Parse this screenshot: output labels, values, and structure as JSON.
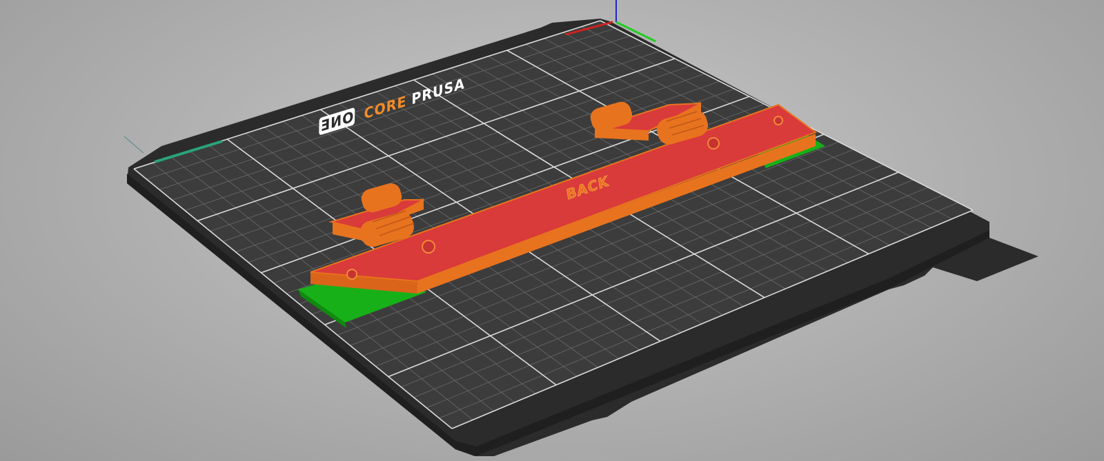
{
  "view": {
    "type": "3d-plater-view"
  },
  "bed": {
    "brand_word_1": "PRUSA",
    "brand_word_2": "CORE",
    "brand_badge": "ONE",
    "plate_color": "#3a3a3a",
    "frame_color": "#2a2a2a",
    "grid_color": "#6b6b6b",
    "grid_major_color": "#dcdcdc",
    "brand_color": "#ffffff",
    "brand_accent_color": "#f28c28"
  },
  "objects": {
    "part_label": "BACK",
    "top_color": "#d93a3a",
    "side_color": "#e8731e",
    "support_color": "#22cc22"
  },
  "axes": {
    "x_color": "#cc2222",
    "y_color": "#22cc22",
    "z_color": "#2222cc"
  }
}
